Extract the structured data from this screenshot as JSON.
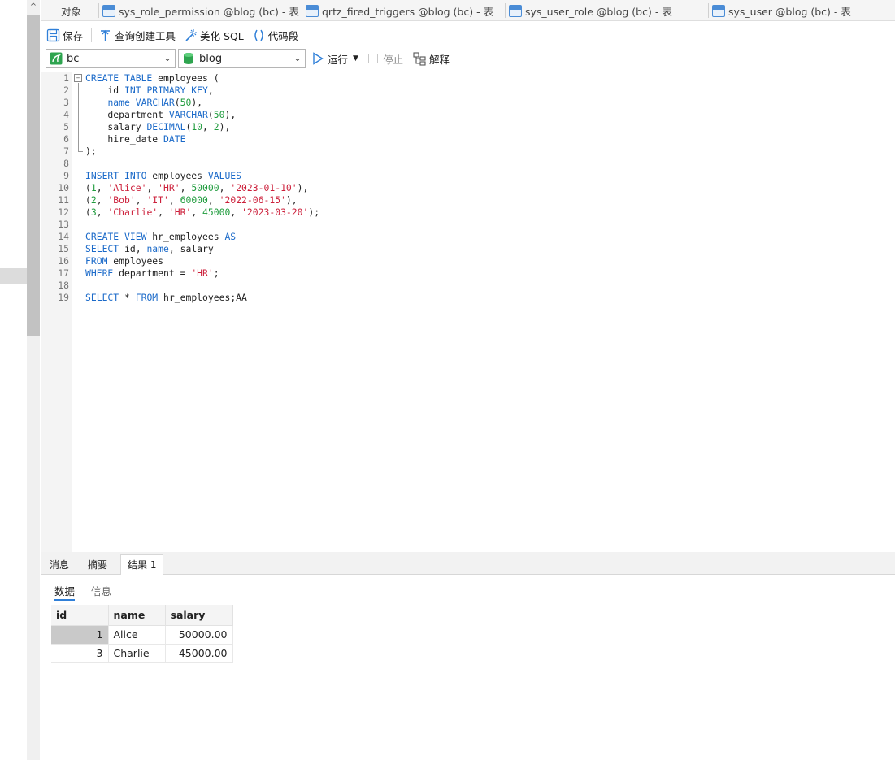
{
  "left_panel": {
    "scroll_up": "^"
  },
  "tabs": [
    {
      "label": "对象",
      "icon": null
    },
    {
      "label": "sys_role_permission @blog (bc) - 表",
      "icon": "table-icon"
    },
    {
      "label": "qrtz_fired_triggers @blog (bc) - 表",
      "icon": "table-icon"
    },
    {
      "label": "sys_user_role @blog (bc) - 表",
      "icon": "table-icon"
    },
    {
      "label": "sys_user @blog (bc) - 表",
      "icon": "table-icon"
    }
  ],
  "toolbar": {
    "save": "保存",
    "query_builder": "查询创建工具",
    "beautify": "美化 SQL",
    "snippet": "代码段"
  },
  "selectors": {
    "connection": "bc",
    "database": "blog",
    "run": "运行",
    "stop": "停止",
    "explain": "解释"
  },
  "editor": {
    "lines": [
      [
        [
          "kw",
          "CREATE TABLE"
        ],
        [
          "t",
          " employees ("
        ]
      ],
      [
        [
          "t",
          "    id "
        ],
        [
          "kw",
          "INT PRIMARY KEY"
        ],
        [
          "t",
          ","
        ]
      ],
      [
        [
          "t",
          "    "
        ],
        [
          "kw",
          "name VARCHAR"
        ],
        [
          "t",
          "("
        ],
        [
          "num",
          "50"
        ],
        [
          "t",
          "),"
        ]
      ],
      [
        [
          "t",
          "    department "
        ],
        [
          "kw",
          "VARCHAR"
        ],
        [
          "t",
          "("
        ],
        [
          "num",
          "50"
        ],
        [
          "t",
          "),"
        ]
      ],
      [
        [
          "t",
          "    salary "
        ],
        [
          "kw",
          "DECIMAL"
        ],
        [
          "t",
          "("
        ],
        [
          "num",
          "10"
        ],
        [
          "t",
          ", "
        ],
        [
          "num",
          "2"
        ],
        [
          "t",
          "),"
        ]
      ],
      [
        [
          "t",
          "    hire_date "
        ],
        [
          "kw",
          "DATE"
        ]
      ],
      [
        [
          "t",
          ");"
        ]
      ],
      [],
      [
        [
          "kw",
          "INSERT INTO"
        ],
        [
          "t",
          " employees "
        ],
        [
          "kw",
          "VALUES"
        ]
      ],
      [
        [
          "t",
          "("
        ],
        [
          "num",
          "1"
        ],
        [
          "t",
          ", "
        ],
        [
          "str",
          "'Alice'"
        ],
        [
          "t",
          ", "
        ],
        [
          "str",
          "'HR'"
        ],
        [
          "t",
          ", "
        ],
        [
          "num",
          "50000"
        ],
        [
          "t",
          ", "
        ],
        [
          "str",
          "'2023-01-10'"
        ],
        [
          "t",
          "),"
        ]
      ],
      [
        [
          "t",
          "("
        ],
        [
          "num",
          "2"
        ],
        [
          "t",
          ", "
        ],
        [
          "str",
          "'Bob'"
        ],
        [
          "t",
          ", "
        ],
        [
          "str",
          "'IT'"
        ],
        [
          "t",
          ", "
        ],
        [
          "num",
          "60000"
        ],
        [
          "t",
          ", "
        ],
        [
          "str",
          "'2022-06-15'"
        ],
        [
          "t",
          "),"
        ]
      ],
      [
        [
          "t",
          "("
        ],
        [
          "num",
          "3"
        ],
        [
          "t",
          ", "
        ],
        [
          "str",
          "'Charlie'"
        ],
        [
          "t",
          ", "
        ],
        [
          "str",
          "'HR'"
        ],
        [
          "t",
          ", "
        ],
        [
          "num",
          "45000"
        ],
        [
          "t",
          ", "
        ],
        [
          "str",
          "'2023-03-20'"
        ],
        [
          "t",
          ");"
        ]
      ],
      [],
      [
        [
          "kw",
          "CREATE VIEW"
        ],
        [
          "t",
          " hr_employees "
        ],
        [
          "kw",
          "AS"
        ]
      ],
      [
        [
          "kw",
          "SELECT"
        ],
        [
          "t",
          " id, "
        ],
        [
          "kw",
          "name"
        ],
        [
          "t",
          ", salary"
        ]
      ],
      [
        [
          "kw",
          "FROM"
        ],
        [
          "t",
          " employees"
        ]
      ],
      [
        [
          "kw",
          "WHERE"
        ],
        [
          "t",
          " department = "
        ],
        [
          "str",
          "'HR'"
        ],
        [
          "t",
          ";"
        ]
      ],
      [],
      [
        [
          "kw",
          "SELECT"
        ],
        [
          "t",
          " * "
        ],
        [
          "kw",
          "FROM"
        ],
        [
          "t",
          " hr_employees;AA"
        ]
      ]
    ]
  },
  "results": {
    "tabs": [
      "消息",
      "摘要",
      "结果 1"
    ],
    "subtabs": [
      "数据",
      "信息"
    ],
    "columns": [
      "id",
      "name",
      "salary"
    ],
    "rows": [
      [
        "1",
        "Alice",
        "50000.00"
      ],
      [
        "3",
        "Charlie",
        "45000.00"
      ]
    ]
  },
  "colors": {
    "keyword": "#1b6ac9",
    "string": "#cc1f3a",
    "number": "#1e9b3c",
    "accent": "#2f7fd8"
  }
}
